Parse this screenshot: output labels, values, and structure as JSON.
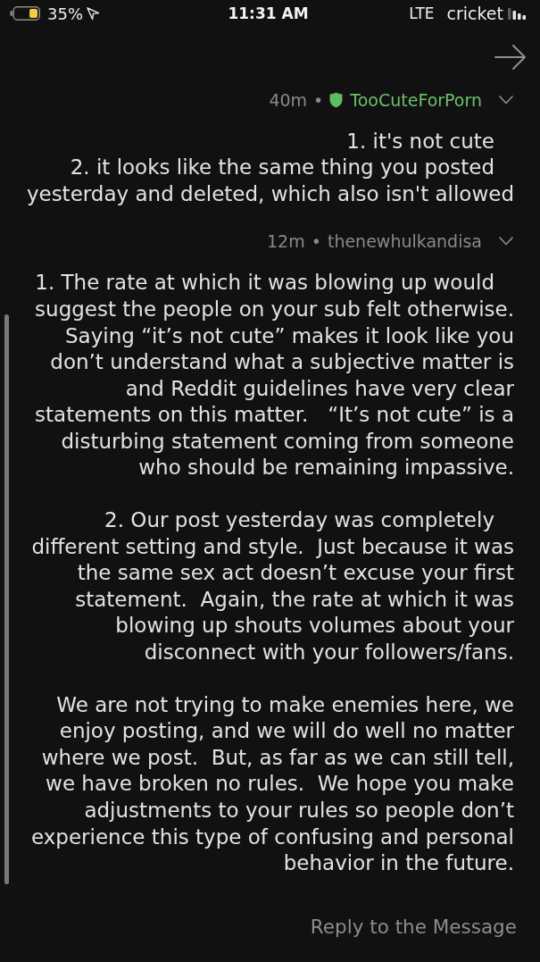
{
  "status_bar": {
    "carrier": "cricket",
    "network": "LTE",
    "time": "11:31 AM",
    "battery_percent": "35%"
  },
  "comments": [
    {
      "author": "TooCuteForPorn",
      "moderator": true,
      "separator": "•",
      "age": "40m",
      "expanded": true,
      "paragraphs": [
        [
          {
            "text": "1. it's not cute",
            "indented": true
          },
          {
            "text": "2. it looks like the same thing you posted yesterday and deleted, which also isn't allowed",
            "indented": true
          }
        ]
      ]
    },
    {
      "author": "thenewhulkandisa",
      "moderator": false,
      "separator": "•",
      "age": "12m",
      "expanded": true,
      "paragraphs": [
        [
          {
            "text": "1. The rate at which it was blowing up would suggest the people on your sub felt otherwise. Saying “it’s not cute” makes it look like you don’t understand what a subjective matter is and Reddit guidelines have very clear statements on this matter.   “It’s not cute” is a disturbing statement coming from someone who should be remaining impassive.",
            "indented": true
          }
        ],
        [
          {
            "text": "2. Our post yesterday was completely different setting and style.  Just because it was the same sex act doesn’t excuse your first statement.  Again, the rate at which it was blowing up shouts volumes about your disconnect with your followers/fans.",
            "indented": true
          }
        ],
        [
          {
            "text": "We are not trying to make enemies here, we enjoy posting, and we will do well no matter where we post.  But, as far as we can still tell, we have broken no rules.  We hope you make adjustments to your rules so people don’t experience this type of confusing and personal behavior in the future.",
            "indented": false
          }
        ]
      ]
    }
  ],
  "reply": {
    "placeholder": "Reply to the Message"
  }
}
